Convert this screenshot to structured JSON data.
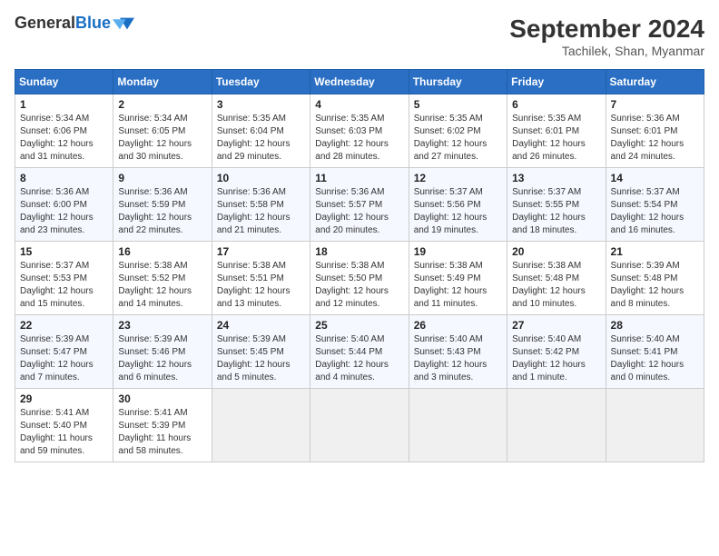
{
  "header": {
    "logo_general": "General",
    "logo_blue": "Blue",
    "month_title": "September 2024",
    "location": "Tachilek, Shan, Myanmar"
  },
  "days_of_week": [
    "Sunday",
    "Monday",
    "Tuesday",
    "Wednesday",
    "Thursday",
    "Friday",
    "Saturday"
  ],
  "weeks": [
    [
      {
        "day": 1,
        "sunrise": "5:34 AM",
        "sunset": "6:06 PM",
        "daylight": "12 hours and 31 minutes."
      },
      {
        "day": 2,
        "sunrise": "5:34 AM",
        "sunset": "6:05 PM",
        "daylight": "12 hours and 30 minutes."
      },
      {
        "day": 3,
        "sunrise": "5:35 AM",
        "sunset": "6:04 PM",
        "daylight": "12 hours and 29 minutes."
      },
      {
        "day": 4,
        "sunrise": "5:35 AM",
        "sunset": "6:03 PM",
        "daylight": "12 hours and 28 minutes."
      },
      {
        "day": 5,
        "sunrise": "5:35 AM",
        "sunset": "6:02 PM",
        "daylight": "12 hours and 27 minutes."
      },
      {
        "day": 6,
        "sunrise": "5:35 AM",
        "sunset": "6:01 PM",
        "daylight": "12 hours and 26 minutes."
      },
      {
        "day": 7,
        "sunrise": "5:36 AM",
        "sunset": "6:01 PM",
        "daylight": "12 hours and 24 minutes."
      }
    ],
    [
      {
        "day": 8,
        "sunrise": "5:36 AM",
        "sunset": "6:00 PM",
        "daylight": "12 hours and 23 minutes."
      },
      {
        "day": 9,
        "sunrise": "5:36 AM",
        "sunset": "5:59 PM",
        "daylight": "12 hours and 22 minutes."
      },
      {
        "day": 10,
        "sunrise": "5:36 AM",
        "sunset": "5:58 PM",
        "daylight": "12 hours and 21 minutes."
      },
      {
        "day": 11,
        "sunrise": "5:36 AM",
        "sunset": "5:57 PM",
        "daylight": "12 hours and 20 minutes."
      },
      {
        "day": 12,
        "sunrise": "5:37 AM",
        "sunset": "5:56 PM",
        "daylight": "12 hours and 19 minutes."
      },
      {
        "day": 13,
        "sunrise": "5:37 AM",
        "sunset": "5:55 PM",
        "daylight": "12 hours and 18 minutes."
      },
      {
        "day": 14,
        "sunrise": "5:37 AM",
        "sunset": "5:54 PM",
        "daylight": "12 hours and 16 minutes."
      }
    ],
    [
      {
        "day": 15,
        "sunrise": "5:37 AM",
        "sunset": "5:53 PM",
        "daylight": "12 hours and 15 minutes."
      },
      {
        "day": 16,
        "sunrise": "5:38 AM",
        "sunset": "5:52 PM",
        "daylight": "12 hours and 14 minutes."
      },
      {
        "day": 17,
        "sunrise": "5:38 AM",
        "sunset": "5:51 PM",
        "daylight": "12 hours and 13 minutes."
      },
      {
        "day": 18,
        "sunrise": "5:38 AM",
        "sunset": "5:50 PM",
        "daylight": "12 hours and 12 minutes."
      },
      {
        "day": 19,
        "sunrise": "5:38 AM",
        "sunset": "5:49 PM",
        "daylight": "12 hours and 11 minutes."
      },
      {
        "day": 20,
        "sunrise": "5:38 AM",
        "sunset": "5:48 PM",
        "daylight": "12 hours and 10 minutes."
      },
      {
        "day": 21,
        "sunrise": "5:39 AM",
        "sunset": "5:48 PM",
        "daylight": "12 hours and 8 minutes."
      }
    ],
    [
      {
        "day": 22,
        "sunrise": "5:39 AM",
        "sunset": "5:47 PM",
        "daylight": "12 hours and 7 minutes."
      },
      {
        "day": 23,
        "sunrise": "5:39 AM",
        "sunset": "5:46 PM",
        "daylight": "12 hours and 6 minutes."
      },
      {
        "day": 24,
        "sunrise": "5:39 AM",
        "sunset": "5:45 PM",
        "daylight": "12 hours and 5 minutes."
      },
      {
        "day": 25,
        "sunrise": "5:40 AM",
        "sunset": "5:44 PM",
        "daylight": "12 hours and 4 minutes."
      },
      {
        "day": 26,
        "sunrise": "5:40 AM",
        "sunset": "5:43 PM",
        "daylight": "12 hours and 3 minutes."
      },
      {
        "day": 27,
        "sunrise": "5:40 AM",
        "sunset": "5:42 PM",
        "daylight": "12 hours and 1 minute."
      },
      {
        "day": 28,
        "sunrise": "5:40 AM",
        "sunset": "5:41 PM",
        "daylight": "12 hours and 0 minutes."
      }
    ],
    [
      {
        "day": 29,
        "sunrise": "5:41 AM",
        "sunset": "5:40 PM",
        "daylight": "11 hours and 59 minutes."
      },
      {
        "day": 30,
        "sunrise": "5:41 AM",
        "sunset": "5:39 PM",
        "daylight": "11 hours and 58 minutes."
      },
      null,
      null,
      null,
      null,
      null
    ]
  ]
}
